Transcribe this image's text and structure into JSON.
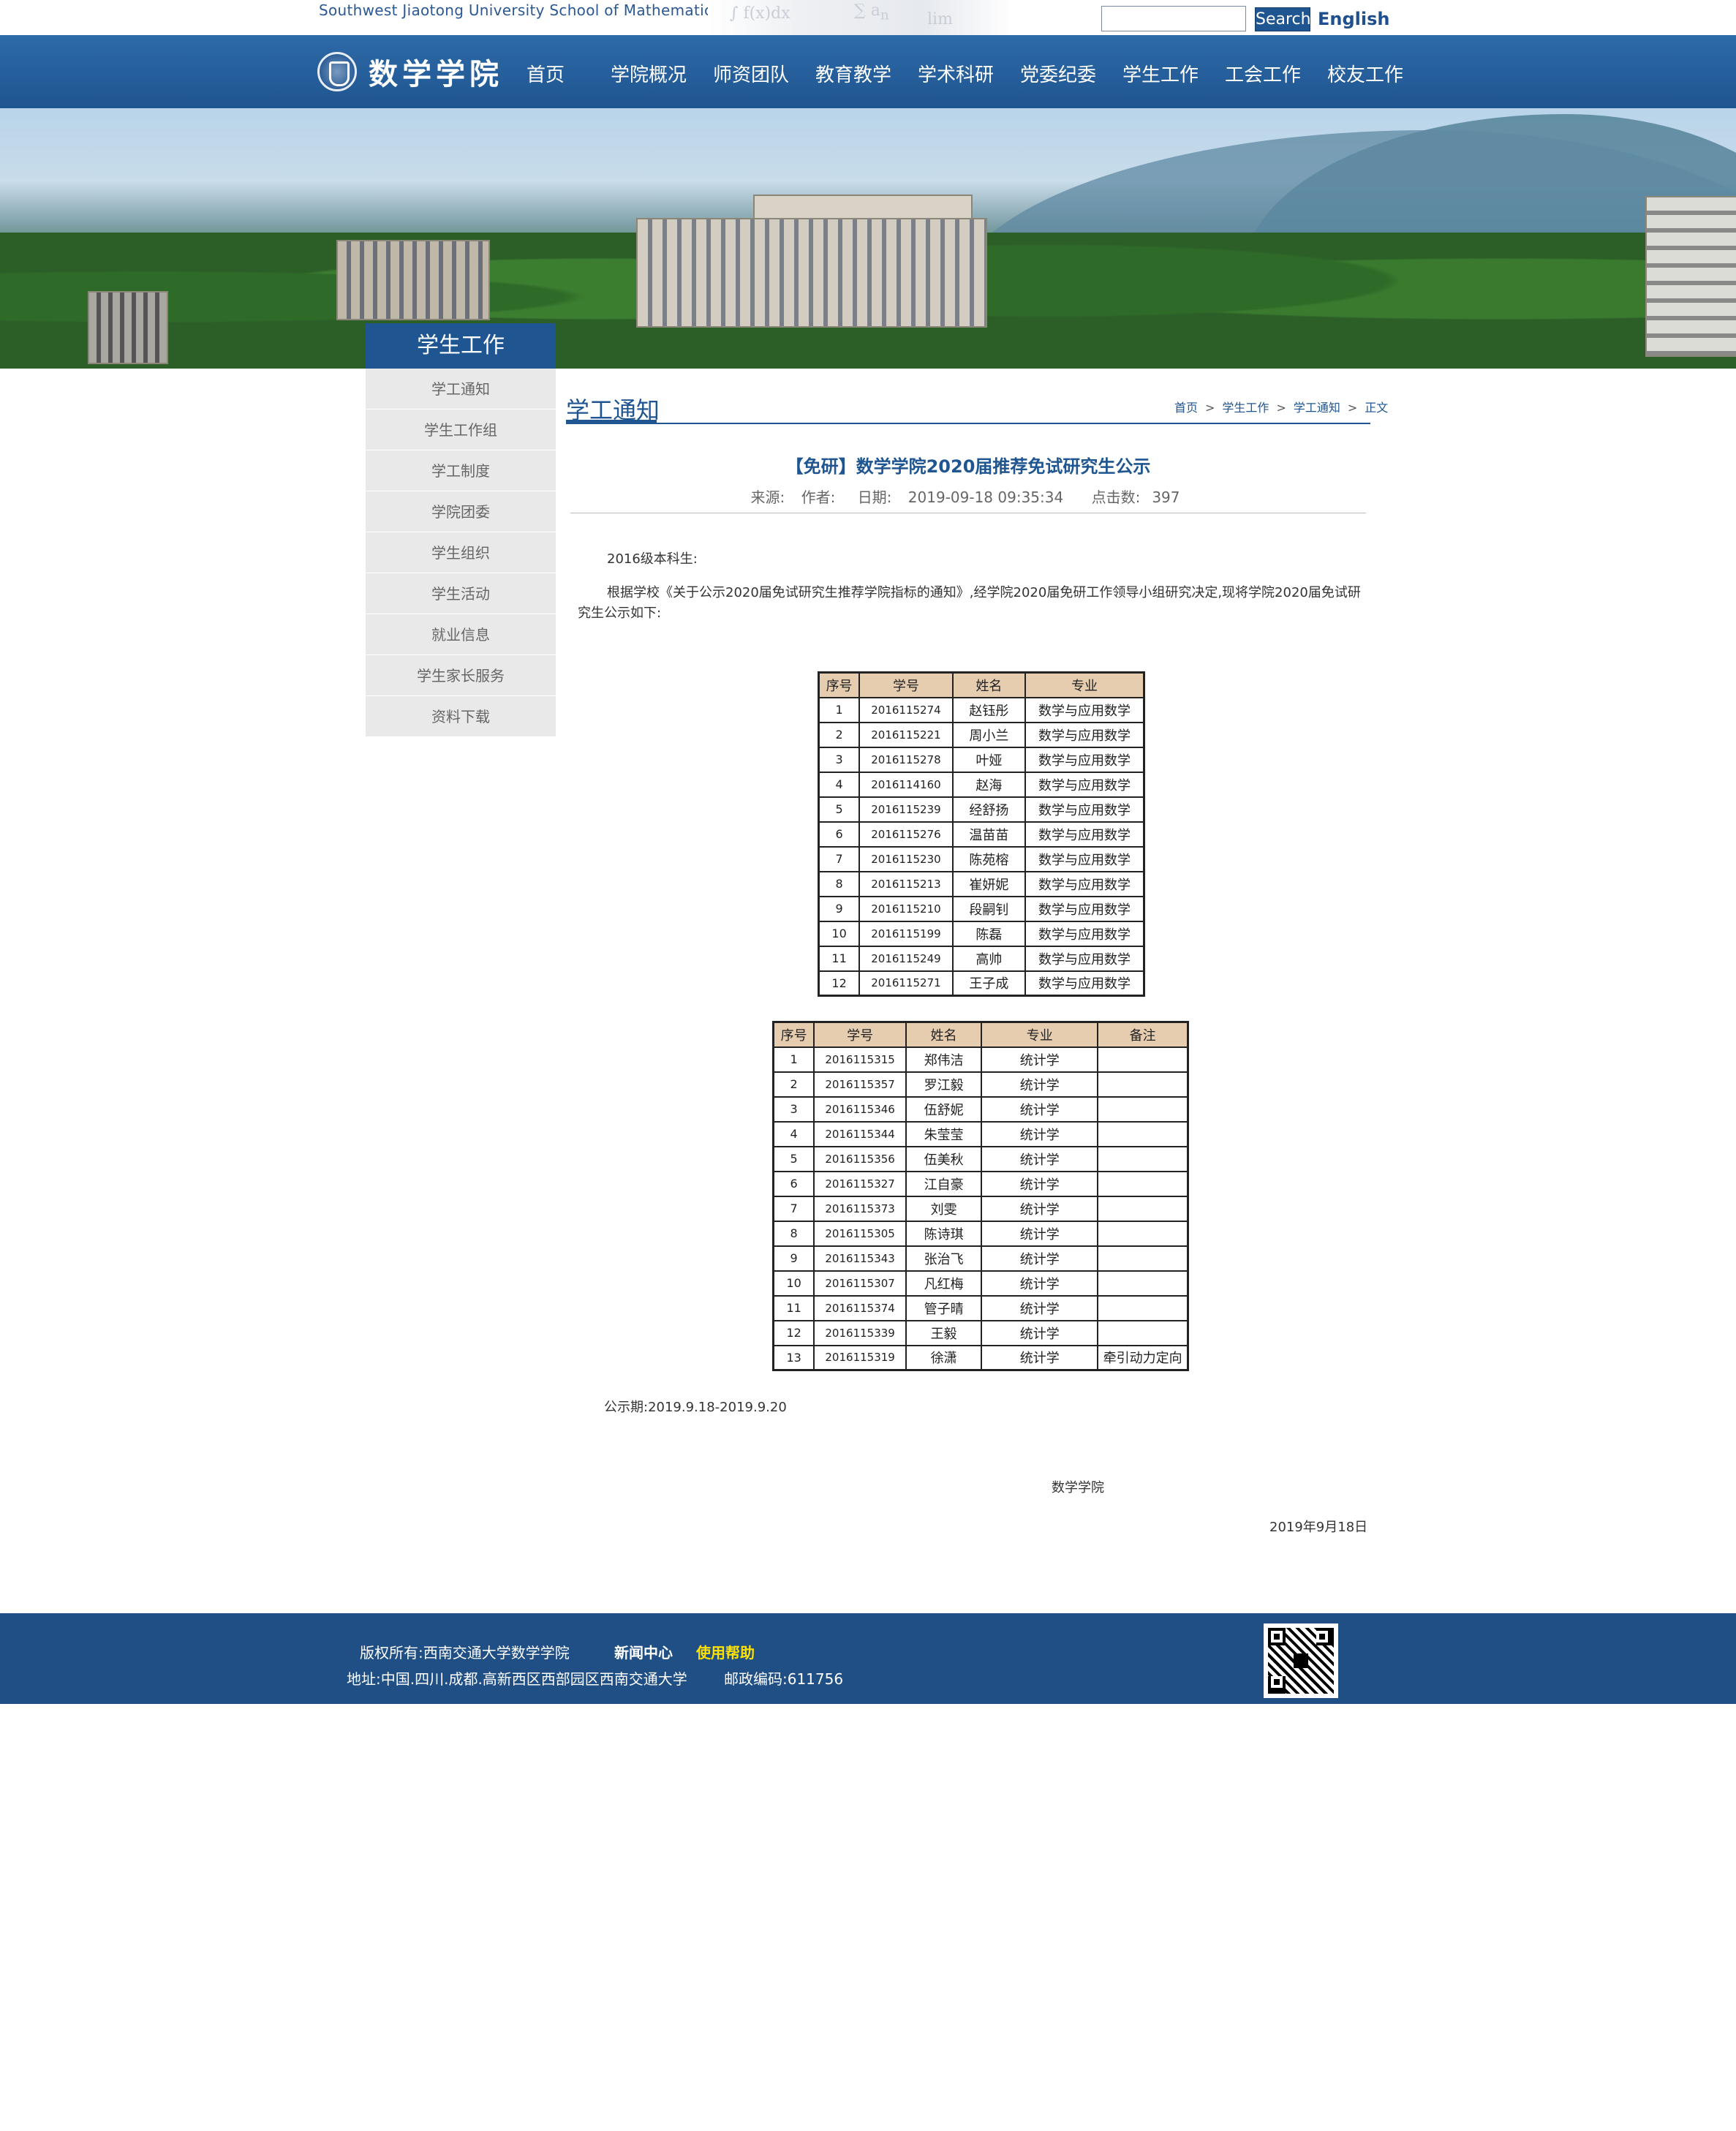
{
  "header": {
    "site_name": "Southwest Jiaotong University School of Mathematics",
    "search_placeholder": "",
    "search_label": "Search",
    "english_label": "English",
    "logo_text": "数学学院"
  },
  "nav": {
    "items": [
      "首页",
      "学院概况",
      "师资团队",
      "教育教学",
      "学术科研",
      "党委纪委",
      "学生工作",
      "工会工作",
      "校友工作"
    ]
  },
  "sidebar": {
    "title": "学生工作",
    "items": [
      "学工通知",
      "学生工作组",
      "学工制度",
      "学院团委",
      "学生组织",
      "学生活动",
      "就业信息",
      "学生家长服务",
      "资料下载"
    ]
  },
  "content": {
    "section_title": "学工通知",
    "breadcrumb": [
      "首页",
      "学生工作",
      "学工通知",
      "正文"
    ],
    "breadcrumb_sep": ">",
    "article": {
      "title": "【免研】数学学院2020届推荐免试研究生公示",
      "source_label": "来源:",
      "author_label": "作者:",
      "date_label": "日期:",
      "date_value": "2019-09-18 09:35:34",
      "hits_label": "点击数:",
      "hits_value": "397",
      "para1": "2016级本科生:",
      "para2": "根据学校《关于公示2020届免试研究生推荐学院指标的通知》,经学院2020届免研工作领导小组研究决定,现将学院2020届免试研究生公示如下:",
      "publicity": "公示期:2019.9.18-2019.9.20",
      "signature": "数学学院",
      "sign_date": "2019年9月18日"
    },
    "table1": {
      "headers": [
        "序号",
        "学号",
        "姓名",
        "专业"
      ],
      "rows": [
        [
          "1",
          "2016115274",
          "赵钰彤",
          "数学与应用数学"
        ],
        [
          "2",
          "2016115221",
          "周小兰",
          "数学与应用数学"
        ],
        [
          "3",
          "2016115278",
          "叶娅",
          "数学与应用数学"
        ],
        [
          "4",
          "2016114160",
          "赵海",
          "数学与应用数学"
        ],
        [
          "5",
          "2016115239",
          "经舒扬",
          "数学与应用数学"
        ],
        [
          "6",
          "2016115276",
          "温苗苗",
          "数学与应用数学"
        ],
        [
          "7",
          "2016115230",
          "陈苑榕",
          "数学与应用数学"
        ],
        [
          "8",
          "2016115213",
          "崔妍妮",
          "数学与应用数学"
        ],
        [
          "9",
          "2016115210",
          "段嗣钊",
          "数学与应用数学"
        ],
        [
          "10",
          "2016115199",
          "陈磊",
          "数学与应用数学"
        ],
        [
          "11",
          "2016115249",
          "高帅",
          "数学与应用数学"
        ],
        [
          "12",
          "2016115271",
          "王子成",
          "数学与应用数学"
        ]
      ]
    },
    "table2": {
      "headers": [
        "序号",
        "学号",
        "姓名",
        "专业",
        "备注"
      ],
      "rows": [
        [
          "1",
          "2016115315",
          "郑伟洁",
          "统计学",
          ""
        ],
        [
          "2",
          "2016115357",
          "罗江毅",
          "统计学",
          ""
        ],
        [
          "3",
          "2016115346",
          "伍舒妮",
          "统计学",
          ""
        ],
        [
          "4",
          "2016115344",
          "朱莹莹",
          "统计学",
          ""
        ],
        [
          "5",
          "2016115356",
          "伍美秋",
          "统计学",
          ""
        ],
        [
          "6",
          "2016115327",
          "江自豪",
          "统计学",
          ""
        ],
        [
          "7",
          "2016115373",
          "刘雯",
          "统计学",
          ""
        ],
        [
          "8",
          "2016115305",
          "陈诗琪",
          "统计学",
          ""
        ],
        [
          "9",
          "2016115343",
          "张治飞",
          "统计学",
          ""
        ],
        [
          "10",
          "2016115307",
          "凡红梅",
          "统计学",
          ""
        ],
        [
          "11",
          "2016115374",
          "管子晴",
          "统计学",
          ""
        ],
        [
          "12",
          "2016115339",
          "王毅",
          "统计学",
          ""
        ],
        [
          "13",
          "2016115319",
          "徐潇",
          "统计学",
          "牵引动力定向"
        ]
      ]
    }
  },
  "footer": {
    "copyright": "版权所有:西南交通大学数学学院",
    "news_link": "新闻中心",
    "help_link": "使用帮助",
    "address": "地址:中国.四川.成都.高新西区西部园区西南交通大学",
    "zip": "邮政编码:611756"
  },
  "colors": {
    "brand_blue": "#1f5590",
    "nav_blue": "#2d6aa8",
    "table_header": "#e6cdb0",
    "help_link": "#ffe100"
  },
  "icons": [
    "university-emblem-icon",
    "qr-code-icon"
  ]
}
